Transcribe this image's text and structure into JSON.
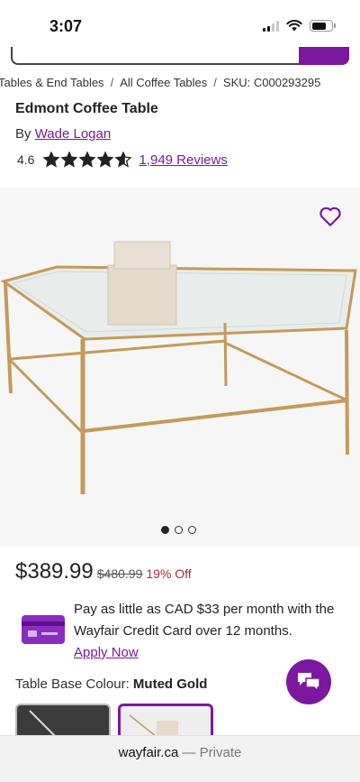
{
  "status_bar": {
    "time": "3:07"
  },
  "breadcrumb": [
    "Tables & End Tables",
    "All Coffee Tables",
    "SKU: C000293295"
  ],
  "product": {
    "title": "Edmont Coffee Table",
    "by_prefix": "By",
    "brand": "Wade Logan",
    "rating": "4.6",
    "rating_value": 4.6,
    "stars_max": 5,
    "reviews": "1,949 Reviews"
  },
  "gallery": {
    "image_count": 3,
    "active_index": 0
  },
  "pricing": {
    "price": "$389.99",
    "old_price": "$480.99",
    "discount": "19% Off"
  },
  "credit": {
    "text": "Pay as little as CAD $33 per month with the Wayfair Credit Card over 12 months.",
    "apply_label": "Apply Now"
  },
  "colour": {
    "label": "Table Base Colour:",
    "selected": "Muted Gold"
  },
  "url_bar": {
    "domain": "wayfair.ca",
    "suffix": "— Private"
  },
  "colors": {
    "accent": "#7b189f",
    "discount": "#b02a2a",
    "gold": "#c49a5a"
  }
}
